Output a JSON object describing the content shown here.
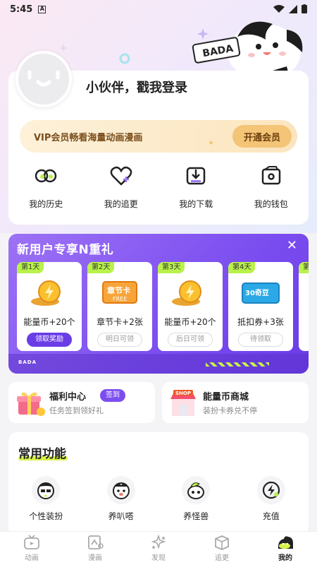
{
  "status_bar": {
    "time": "5:45",
    "sim_label": "A"
  },
  "mascot": {
    "brand": "BADA"
  },
  "profile": {
    "login_prompt": "小伙伴，戳我登录"
  },
  "vip": {
    "text": "VIP会员畅看海量动画漫画",
    "button": "开通会员"
  },
  "quick_actions": [
    {
      "label": "我的历史",
      "icon": "eyes-icon"
    },
    {
      "label": "我的追更",
      "icon": "heart-plus-icon"
    },
    {
      "label": "我的下载",
      "icon": "download-icon"
    },
    {
      "label": "我的钱包",
      "icon": "wallet-icon"
    }
  ],
  "promo": {
    "title": "新用户专享N重礼",
    "brand": "BADA",
    "cards": [
      {
        "day": "第1天",
        "label": "能量币+20个",
        "button": "领取奖励",
        "image_text": ""
      },
      {
        "day": "第2天",
        "label": "章节卡+2张",
        "button": "明日可领",
        "image_text": "章节卡"
      },
      {
        "day": "第3天",
        "label": "能量币+20个",
        "button": "后日可领",
        "image_text": ""
      },
      {
        "day": "第4天",
        "label": "抵扣券+3张",
        "button": "待领取",
        "image_text": "30奇豆"
      },
      {
        "day": "第",
        "label": "",
        "button": "",
        "image_text": ""
      }
    ]
  },
  "services": {
    "welfare": {
      "title": "福利中心",
      "badge": "签到",
      "subtitle": "任务签到领好礼"
    },
    "shop": {
      "title": "能量币商城",
      "subtitle": "装扮卡券兑不停",
      "sign": "SHOP"
    }
  },
  "common": {
    "title": "常用功能",
    "items": [
      {
        "label": "个性装扮",
        "icon": "dressup-icon"
      },
      {
        "label": "养叭嗒",
        "icon": "pet-icon"
      },
      {
        "label": "养怪兽",
        "icon": "monster-icon"
      },
      {
        "label": "充值",
        "icon": "recharge-icon"
      }
    ]
  },
  "tabbar": [
    {
      "label": "动画",
      "icon": "tv-icon",
      "active": false
    },
    {
      "label": "漫画",
      "icon": "comic-icon",
      "active": false
    },
    {
      "label": "发现",
      "icon": "discover-icon",
      "active": false
    },
    {
      "label": "追更",
      "icon": "box-icon",
      "active": false
    },
    {
      "label": "我的",
      "icon": "profile-icon",
      "active": true
    }
  ]
}
